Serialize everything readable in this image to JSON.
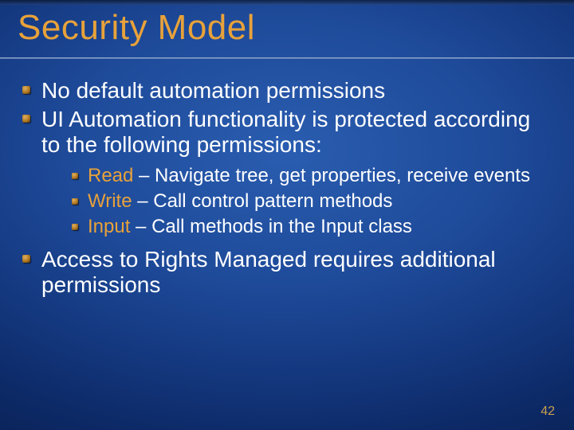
{
  "title": "Security Model",
  "bullets": {
    "b1": "No default automation permissions",
    "b2": "UI Automation functionality is protected according to the following permissions:",
    "b3": "Access to Rights Managed requires additional permissions"
  },
  "perms": {
    "read": {
      "label": "Read",
      "desc": " – Navigate tree, get properties, receive events"
    },
    "write": {
      "label": "Write",
      "desc": " – Call control pattern methods"
    },
    "input": {
      "label": "Input",
      "desc": " – Call methods in the Input class"
    }
  },
  "page_number": "42"
}
